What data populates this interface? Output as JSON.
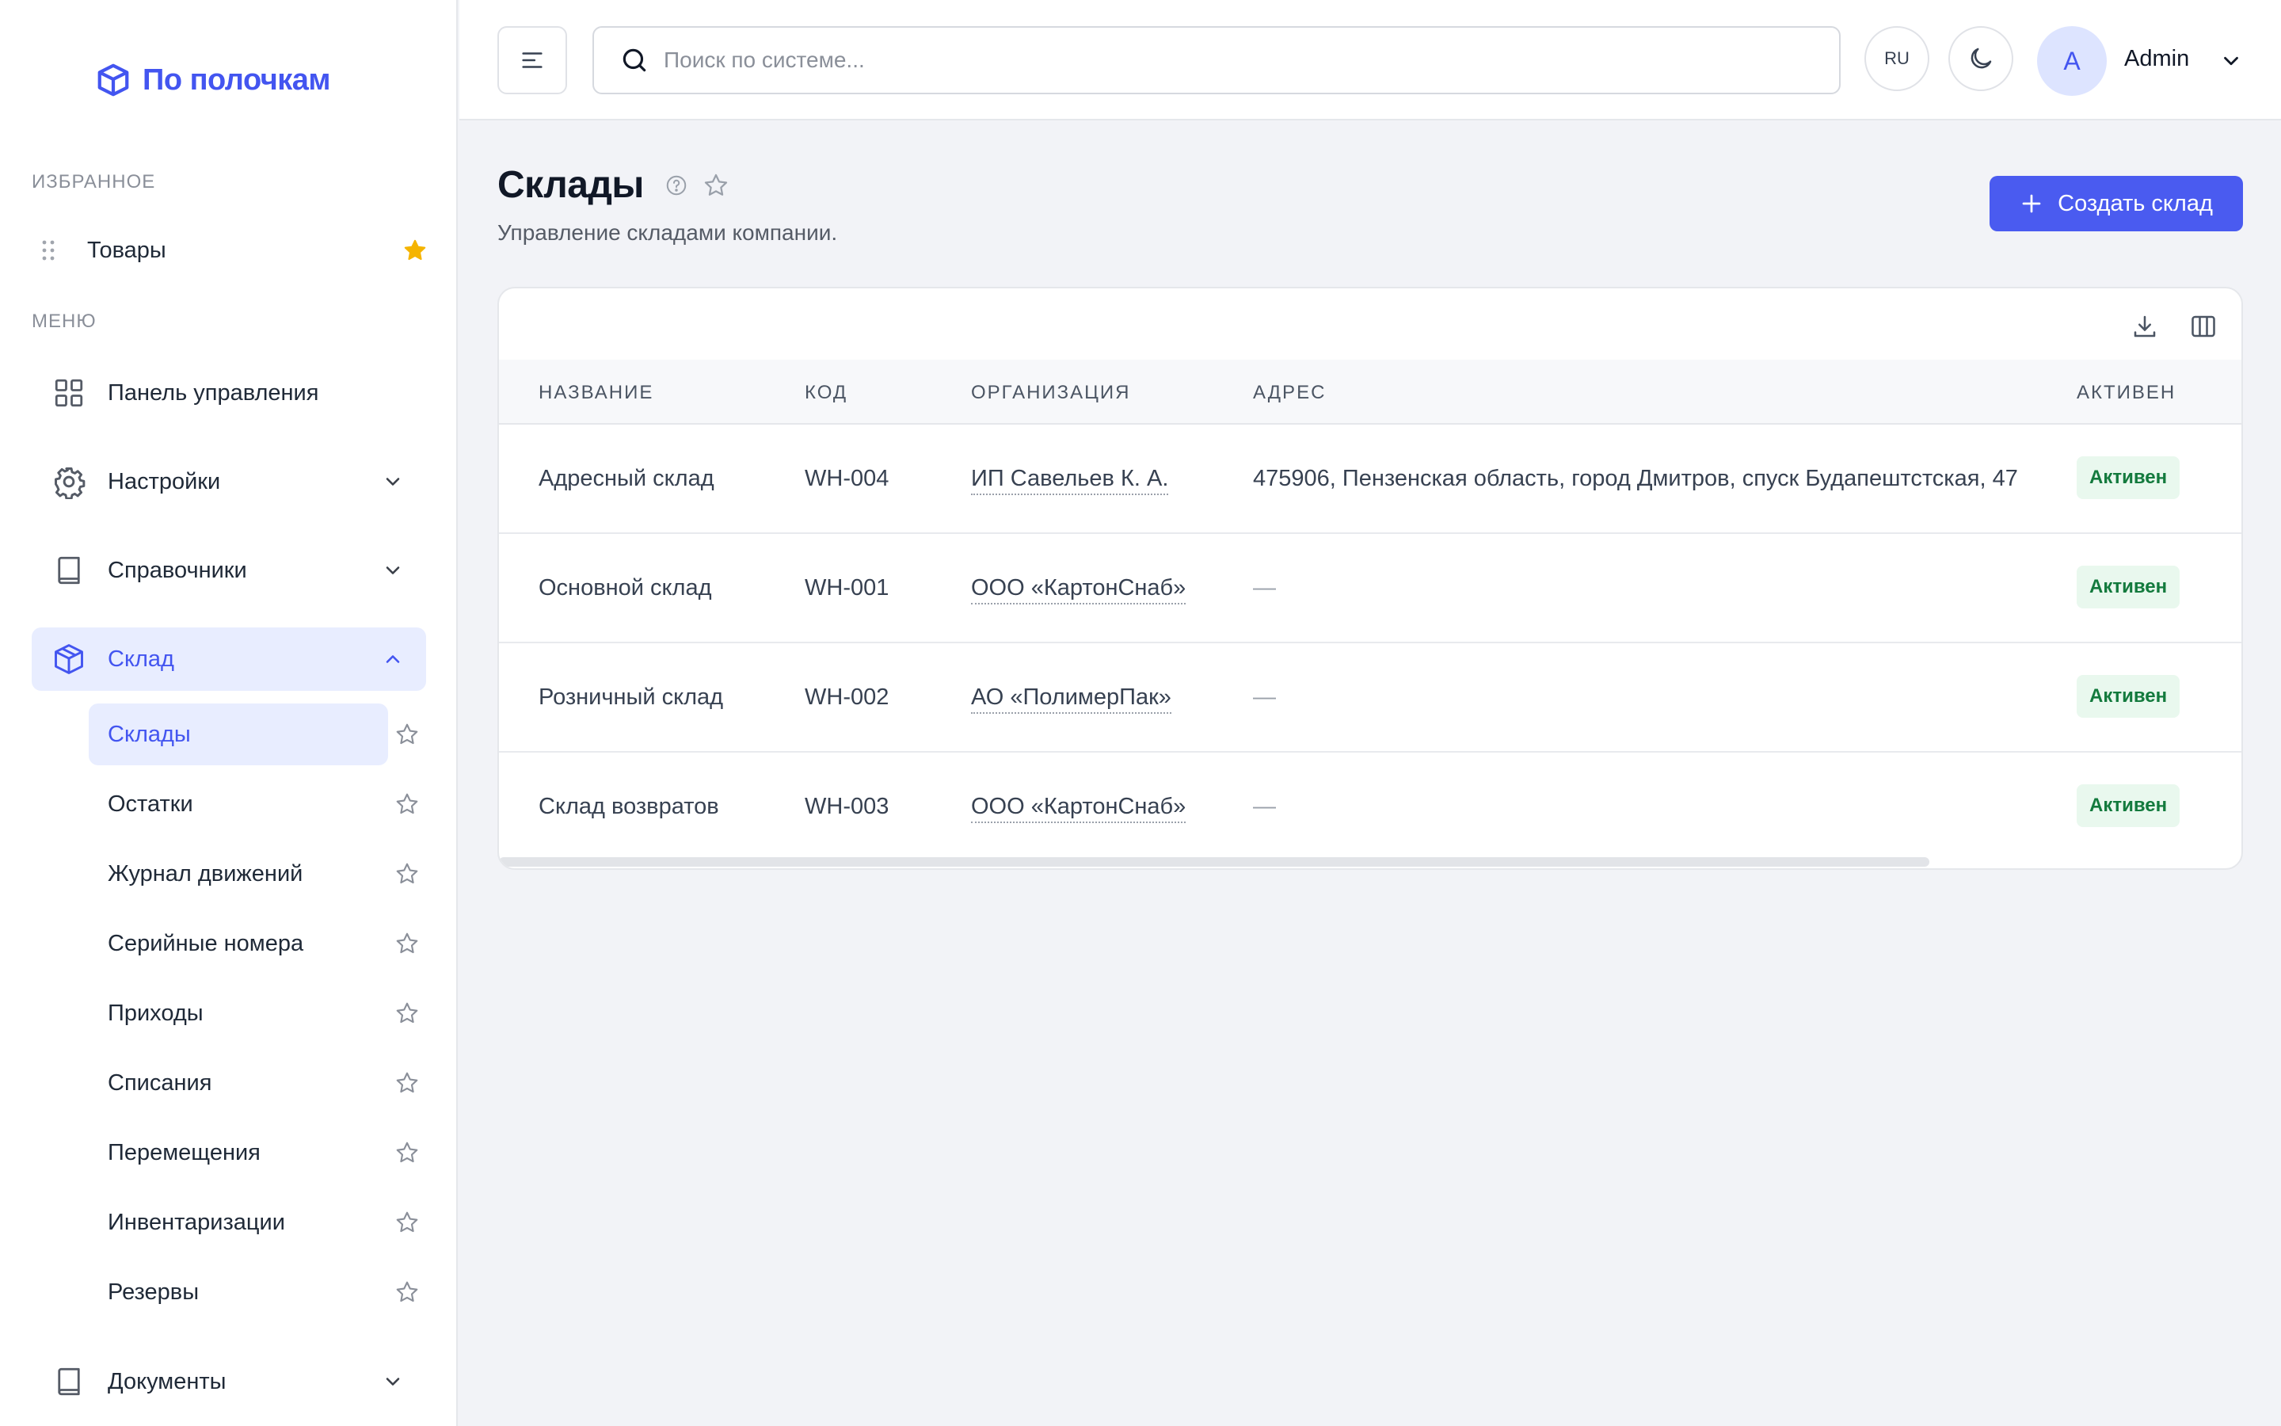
{
  "app": {
    "logo_text": "По полочкам"
  },
  "sidebar": {
    "favorites_label": "Избранное",
    "favorites": [
      {
        "label": "Товары",
        "starred": true
      }
    ],
    "menu_label": "Меню",
    "items": [
      {
        "label": "Панель управления",
        "icon": "dashboard-grid-icon"
      },
      {
        "label": "Настройки",
        "icon": "gear-icon",
        "expanded": false
      },
      {
        "label": "Справочники",
        "icon": "book-icon",
        "expanded": false
      },
      {
        "label": "Склад",
        "icon": "box-icon",
        "expanded": true,
        "active": true
      },
      {
        "label": "Документы",
        "icon": "book-icon",
        "expanded": false
      }
    ],
    "warehouse_subitems": [
      {
        "label": "Склады",
        "active": true
      },
      {
        "label": "Остатки"
      },
      {
        "label": "Журнал движений"
      },
      {
        "label": "Серийные номера"
      },
      {
        "label": "Приходы"
      },
      {
        "label": "Списания"
      },
      {
        "label": "Перемещения"
      },
      {
        "label": "Инвентаризации"
      },
      {
        "label": "Резервы"
      }
    ]
  },
  "header": {
    "search_placeholder": "Поиск по системе...",
    "language": "RU",
    "avatar_letter": "A",
    "user_name": "Admin"
  },
  "page": {
    "title": "Склады",
    "subtitle": "Управление складами компании.",
    "create_button": "Создать склад"
  },
  "table": {
    "columns": [
      "Название",
      "Код",
      "Организация",
      "Адрес",
      "Активен"
    ],
    "rows": [
      {
        "name": "Адресный склад",
        "code": "WH-004",
        "org": "ИП Савельев К. А.",
        "address": "475906, Пензенская область, город Дмитров, спуск Будапештстская, 47",
        "active": "Активен"
      },
      {
        "name": "Основной склад",
        "code": "WH-001",
        "org": "ООО «КартонСнаб»",
        "address": "—",
        "active": "Активен"
      },
      {
        "name": "Розничный склад",
        "code": "WH-002",
        "org": "АО «ПолимерПак»",
        "address": "—",
        "active": "Активен"
      },
      {
        "name": "Склад возвратов",
        "code": "WH-003",
        "org": "ООО «КартонСнаб»",
        "address": "—",
        "active": "Активен"
      }
    ]
  },
  "colors": {
    "accent": "#4a5bf0",
    "active_bg": "#e8edff",
    "badge_bg": "#e9f8ee",
    "badge_text": "#137a3d",
    "star_filled": "#f5b400"
  }
}
